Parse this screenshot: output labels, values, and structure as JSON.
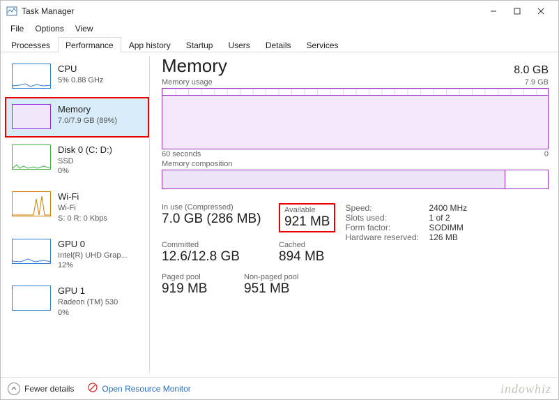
{
  "window": {
    "title": "Task Manager"
  },
  "menu": {
    "file": "File",
    "options": "Options",
    "view": "View"
  },
  "tabs": {
    "processes": "Processes",
    "performance": "Performance",
    "app_history": "App history",
    "startup": "Startup",
    "users": "Users",
    "details": "Details",
    "services": "Services"
  },
  "sidebar": {
    "cpu": {
      "name": "CPU",
      "sub": "5%  0.88 GHz"
    },
    "mem": {
      "name": "Memory",
      "sub": "7.0/7.9 GB (89%)"
    },
    "disk": {
      "name": "Disk 0 (C: D:)",
      "sub1": "SSD",
      "sub2": "0%"
    },
    "wifi": {
      "name": "Wi-Fi",
      "sub1": "Wi-Fi",
      "sub2": "S: 0  R: 0 Kbps"
    },
    "gpu0": {
      "name": "GPU 0",
      "sub1": "Intel(R) UHD Grap...",
      "sub2": "12%"
    },
    "gpu1": {
      "name": "GPU 1",
      "sub1": "Radeon (TM) 530",
      "sub2": "0%"
    }
  },
  "detail": {
    "title": "Memory",
    "total": "8.0 GB",
    "usage_label": "Memory usage",
    "usage_right": "7.9 GB",
    "axis_left": "60 seconds",
    "axis_right": "0",
    "comp_label": "Memory composition",
    "inuse_lbl": "In use (Compressed)",
    "inuse_val": "7.0 GB (286 MB)",
    "avail_lbl": "Available",
    "avail_val": "921 MB",
    "committed_lbl": "Committed",
    "committed_val": "12.6/12.8 GB",
    "cached_lbl": "Cached",
    "cached_val": "894 MB",
    "paged_lbl": "Paged pool",
    "paged_val": "919 MB",
    "nonpaged_lbl": "Non-paged pool",
    "nonpaged_val": "951 MB",
    "spec": {
      "speed_lbl": "Speed:",
      "speed_val": "2400 MHz",
      "slots_lbl": "Slots used:",
      "slots_val": "1 of 2",
      "form_lbl": "Form factor:",
      "form_val": "SODIMM",
      "hw_lbl": "Hardware reserved:",
      "hw_val": "126 MB"
    }
  },
  "bottom": {
    "fewer": "Fewer details",
    "monitor": "Open Resource Monitor"
  },
  "watermark": "indowhiz",
  "chart_data": {
    "type": "line",
    "title": "Memory usage",
    "xlabel": "seconds ago",
    "ylabel": "GB",
    "ylim": [
      0,
      7.9
    ],
    "x": [
      60,
      55,
      50,
      45,
      40,
      35,
      30,
      25,
      20,
      15,
      10,
      5,
      0
    ],
    "values": [
      7.0,
      7.0,
      7.0,
      7.0,
      7.0,
      7.0,
      7.0,
      7.0,
      7.0,
      7.0,
      7.0,
      7.0,
      7.0
    ],
    "composition": {
      "in_use_gb": 7.0,
      "available_gb": 0.9
    }
  }
}
